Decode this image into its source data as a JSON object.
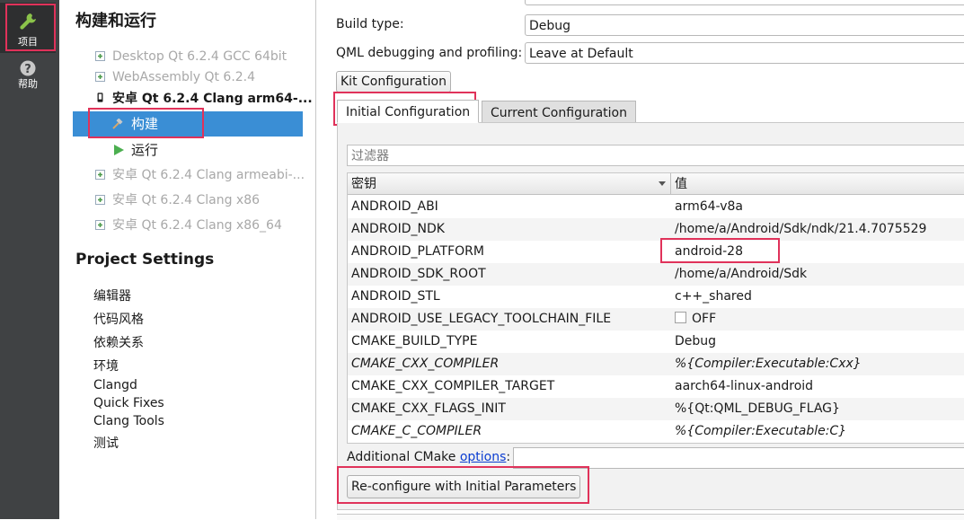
{
  "modebar": {
    "items": [
      {
        "label": "项目",
        "icon": "wrench-icon",
        "active": true
      },
      {
        "label": "帮助",
        "icon": "question-icon",
        "active": false
      }
    ]
  },
  "left": {
    "title": "构建和运行",
    "kits": [
      {
        "label": "Desktop Qt 6.2.4 GCC 64bit",
        "state": "dim"
      },
      {
        "label": "WebAssembly Qt 6.2.4",
        "state": "dim"
      },
      {
        "label": "安卓 Qt 6.2.4 Clang arm64-...",
        "state": "active"
      },
      {
        "label": "安卓 Qt 6.2.4 Clang armeabi-...",
        "state": "dim"
      },
      {
        "label": "安卓 Qt 6.2.4 Clang x86",
        "state": "dim"
      },
      {
        "label": "安卓 Qt 6.2.4 Clang x86_64",
        "state": "dim"
      }
    ],
    "build_label": "构建",
    "run_label": "运行",
    "project_settings_title": "Project Settings",
    "settings": [
      "编辑器",
      "代码风格",
      "依赖关系",
      "环境",
      "Clangd",
      "Quick Fixes",
      "Clang Tools",
      "测试"
    ]
  },
  "main": {
    "build_type_label": "Build type:",
    "build_type_value": "Debug",
    "qml_label": "QML debugging and profiling:",
    "qml_value": "Leave at Default",
    "kit_config_button": "Kit Configuration",
    "tabs": [
      "Initial Configuration",
      "Current Configuration"
    ],
    "filter_placeholder": "过滤器",
    "columns": [
      "密钥",
      "值"
    ],
    "rows": [
      {
        "key": "ANDROID_ABI",
        "value": "arm64-v8a"
      },
      {
        "key": "ANDROID_NDK",
        "value": "/home/a/Android/Sdk/ndk/21.4.7075529"
      },
      {
        "key": "ANDROID_PLATFORM",
        "value": "android-28"
      },
      {
        "key": "ANDROID_SDK_ROOT",
        "value": "/home/a/Android/Sdk"
      },
      {
        "key": "ANDROID_STL",
        "value": "c++_shared"
      },
      {
        "key": "ANDROID_USE_LEGACY_TOOLCHAIN_FILE",
        "value": "OFF"
      },
      {
        "key": "CMAKE_BUILD_TYPE",
        "value": "Debug"
      },
      {
        "key": "CMAKE_CXX_COMPILER",
        "value": "%{Compiler:Executable:Cxx}"
      },
      {
        "key": "CMAKE_CXX_COMPILER_TARGET",
        "value": "aarch64-linux-android"
      },
      {
        "key": "CMAKE_CXX_FLAGS_INIT",
        "value": "%{Qt:QML_DEBUG_FLAG}"
      },
      {
        "key": "CMAKE_C_COMPILER",
        "value": "%{Compiler:Executable:C}"
      }
    ],
    "additional_label": "Additional CMake ",
    "additional_link": "options",
    "additional_colon": ":",
    "reconfigure_button": "Re-configure with Initial Parameters"
  },
  "colors": {
    "highlight": "#e0325a",
    "selection": "#3a8ed5",
    "modebar": "#404244"
  }
}
